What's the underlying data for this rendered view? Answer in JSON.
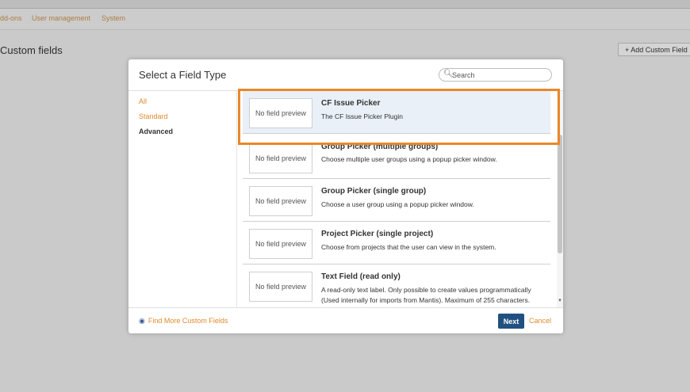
{
  "nav": {
    "items": [
      "dd-ons",
      "User management",
      "System"
    ]
  },
  "page": {
    "title": "Custom fields",
    "add_button": "+ Add Custom Field"
  },
  "dialog": {
    "title": "Select a Field Type",
    "search": {
      "placeholder": "Search",
      "value": ""
    },
    "categories": [
      {
        "label": "All",
        "active": false
      },
      {
        "label": "Standard",
        "active": false
      },
      {
        "label": "Advanced",
        "active": true
      }
    ],
    "fields": [
      {
        "preview": "No field preview",
        "title": "CF Issue Picker",
        "description": "The CF Issue Picker Plugin",
        "selected": true
      },
      {
        "preview": "No field preview",
        "title": "Group Picker (multiple groups)",
        "description": "Choose multiple user groups using a popup picker window.",
        "selected": false
      },
      {
        "preview": "No field preview",
        "title": "Group Picker (single group)",
        "description": "Choose a user group using a popup picker window.",
        "selected": false
      },
      {
        "preview": "No field preview",
        "title": "Project Picker (single project)",
        "description": "Choose from projects that the user can view in the system.",
        "selected": false
      },
      {
        "preview": "No field preview",
        "title": "Text Field (read only)",
        "description": "A read-only text label. Only possible to create values programmatically (Used internally for imports from Mantis). Maximum of 255 characters.",
        "selected": false
      }
    ],
    "footer": {
      "find_more": "Find More Custom Fields",
      "next": "Next",
      "cancel": "Cancel"
    }
  },
  "colors": {
    "accent": "#e08a2c",
    "primary": "#205081",
    "highlight": "#e8882a"
  }
}
